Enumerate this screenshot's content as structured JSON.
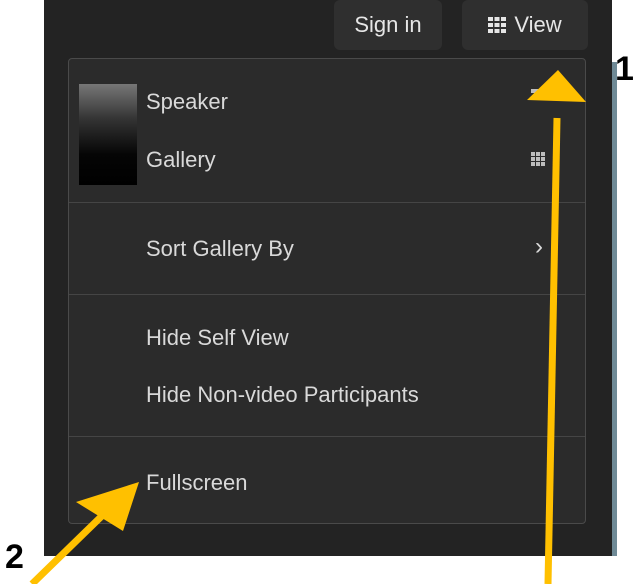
{
  "header": {
    "sign_in_label": "Sign in",
    "view_label": "View"
  },
  "menu": {
    "items": [
      {
        "label": "Speaker"
      },
      {
        "label": "Gallery"
      },
      {
        "label": "Sort Gallery By"
      },
      {
        "label": "Hide Self View"
      },
      {
        "label": "Hide Non-video Participants"
      },
      {
        "label": "Fullscreen"
      }
    ]
  },
  "annotations": {
    "marker_1": "1",
    "marker_2": "2",
    "arrow_color": "#FFC000"
  },
  "icons": {
    "view": "grid-icon",
    "speaker": "grid-icon",
    "gallery": "grid-icon",
    "sort": "chevron-right-icon"
  }
}
